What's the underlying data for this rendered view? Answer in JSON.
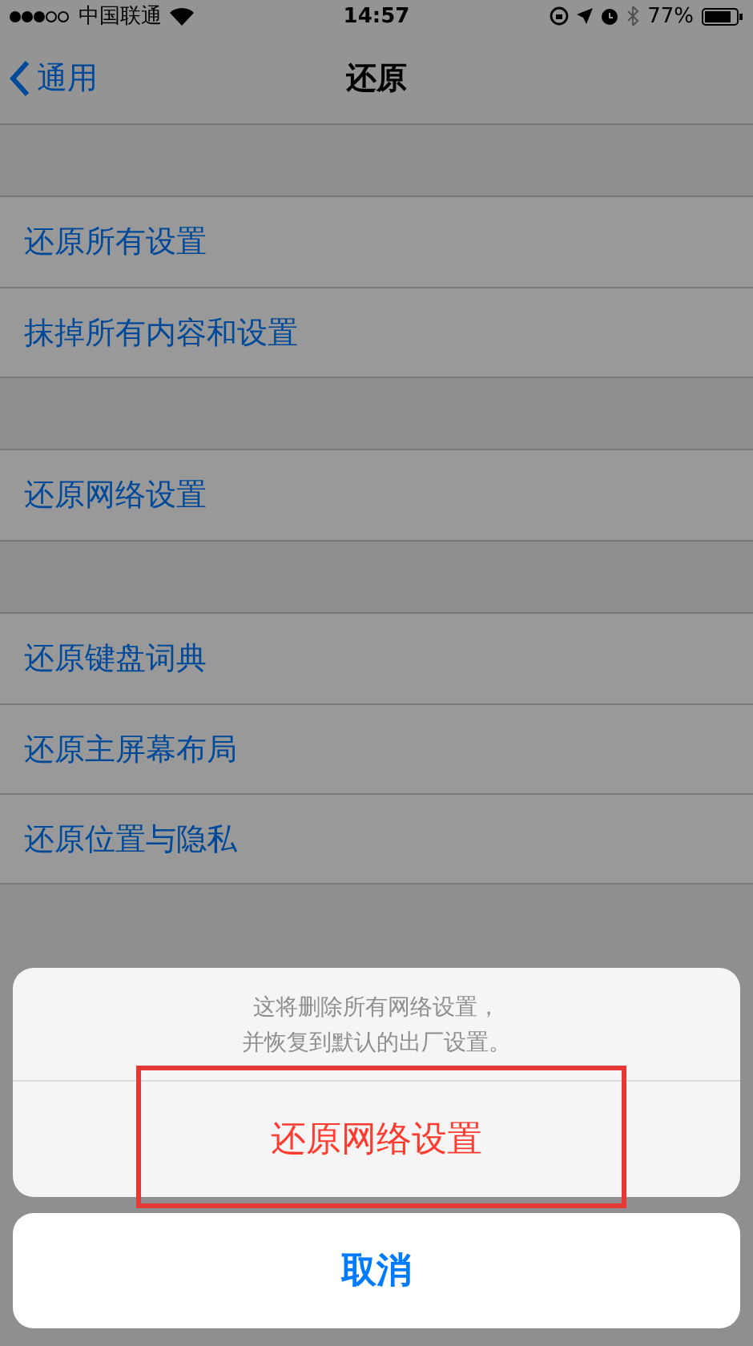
{
  "status_bar": {
    "carrier": "中国联通",
    "time": "14:57",
    "battery": "77%"
  },
  "nav": {
    "back": "通用",
    "title": "还原"
  },
  "groups": [
    {
      "items": [
        "还原所有设置",
        "抹掉所有内容和设置"
      ]
    },
    {
      "items": [
        "还原网络设置"
      ]
    },
    {
      "items": [
        "还原键盘词典",
        "还原主屏幕布局",
        "还原位置与隐私"
      ]
    }
  ],
  "action_sheet": {
    "message_lines": [
      "这将删除所有网络设置，",
      "并恢复到默认的出厂设置。"
    ],
    "actions": [
      {
        "label": "还原网络设置",
        "kind": "destructive",
        "highlighted": true
      }
    ],
    "cancel": "取消"
  }
}
